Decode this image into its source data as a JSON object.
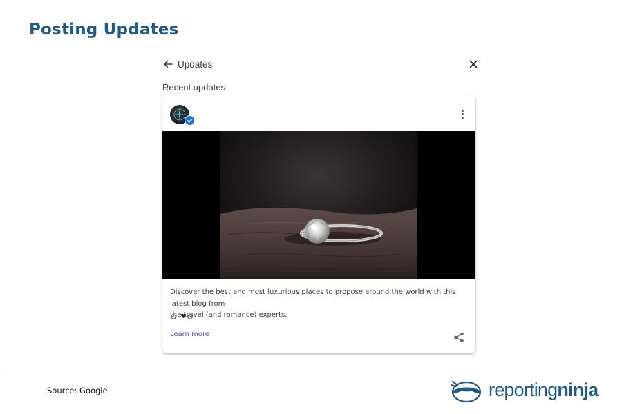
{
  "page": {
    "title": "Posting Updates"
  },
  "panel": {
    "header_title": "Updates",
    "section_label": "Recent updates",
    "icons": {
      "back": "arrow-left-icon",
      "close": "close-icon"
    }
  },
  "post": {
    "text_line1": "Discover the best and most luxurious places to propose around the world with this latest blog from",
    "text_line2": "the travel (and romance) experts.",
    "emojis": [
      "ring",
      "heart",
      "ring"
    ],
    "link_label": "Learn more",
    "icons": {
      "menu": "more-vertical-icon",
      "share": "share-icon",
      "verified": "verified-badge-icon"
    },
    "image": "diamond-ring-photo"
  },
  "footer": {
    "source": "Source: Google",
    "logo_text_light": "reporting",
    "logo_text_bold": "ninja"
  },
  "colors": {
    "title": "#1f5b86",
    "link": "#4545cc",
    "badge": "#1a73e8",
    "logo": "#1f5b86"
  }
}
